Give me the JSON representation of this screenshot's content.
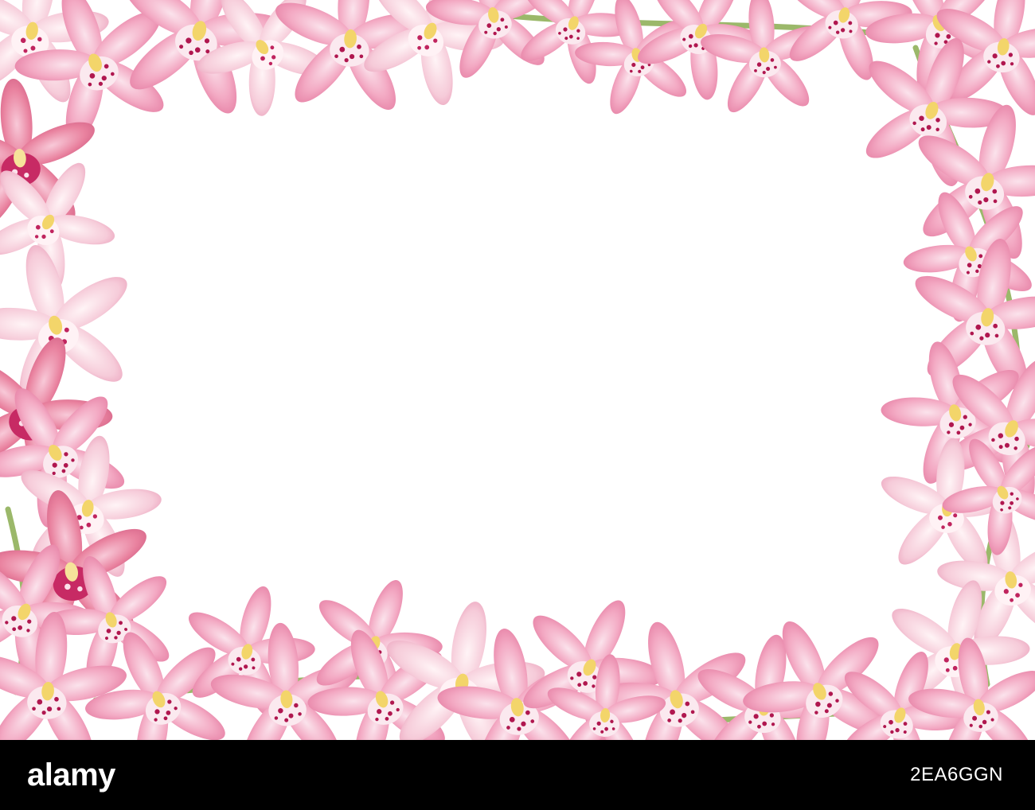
{
  "photo": {
    "description_icon": "orchid-frame-photo",
    "colors": {
      "petal_light": "#f7c6d6",
      "petal_mid": "#f09bb8",
      "petal_deep": "#d95d8a",
      "lip_spot": "#b0174f",
      "column_yellow": "#f3d56a",
      "stem_green": "#9bb86a",
      "background": "#ffffff"
    }
  },
  "watermark_bar": {
    "logo_text": "alamy",
    "image_id": "2EA6GGN",
    "background": "#000000",
    "text_color": "#ffffff"
  }
}
